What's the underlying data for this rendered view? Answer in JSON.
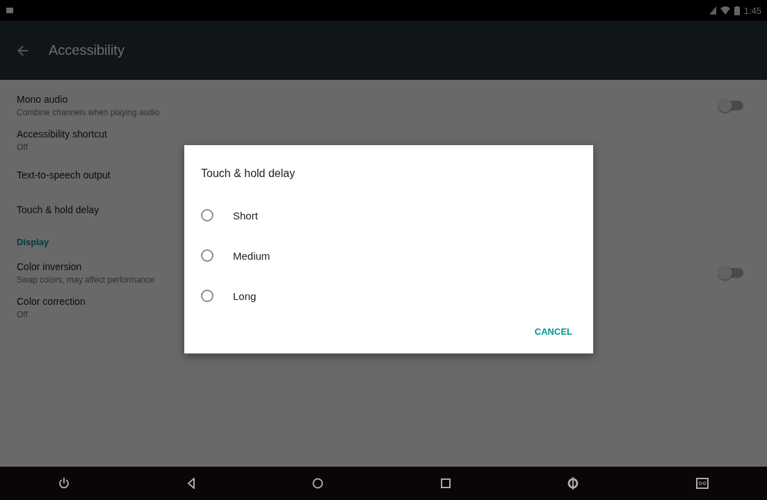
{
  "status_bar": {
    "time": "1:45"
  },
  "toolbar": {
    "title": "Accessibility"
  },
  "settings": [
    {
      "kind": "switch",
      "title": "Mono audio",
      "summary": "Combine channels when playing audio",
      "on": false
    },
    {
      "kind": "item",
      "title": "Accessibility shortcut",
      "summary": "Off"
    },
    {
      "kind": "item",
      "title": "Text-to-speech output"
    },
    {
      "kind": "item",
      "title": "Touch & hold delay"
    },
    {
      "kind": "header",
      "title": "Display"
    },
    {
      "kind": "switch",
      "title": "Color inversion",
      "summary": "Swap colors, may affect performance",
      "on": false
    },
    {
      "kind": "item",
      "title": "Color correction",
      "summary": "Off"
    }
  ],
  "dialog": {
    "title": "Touch & hold delay",
    "options": [
      {
        "label": "Short",
        "selected": false
      },
      {
        "label": "Medium",
        "selected": false
      },
      {
        "label": "Long",
        "selected": false
      }
    ],
    "button": "CANCEL"
  }
}
